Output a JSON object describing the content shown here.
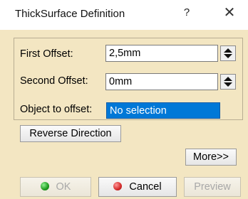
{
  "window": {
    "title": "ThickSurface Definition",
    "help_glyph": "?",
    "close_glyph": "✕"
  },
  "form": {
    "first_offset": {
      "label": "First Offset:",
      "value": "2,5mm"
    },
    "second_offset": {
      "label": "Second Offset:",
      "value": "0mm"
    },
    "object_to_offset": {
      "label": "Object to offset:",
      "value": "No selection"
    }
  },
  "buttons": {
    "reverse_direction": "Reverse Direction",
    "more": "More>>",
    "ok": "OK",
    "cancel": "Cancel",
    "preview": "Preview"
  },
  "colors": {
    "background": "#f3e6c2",
    "selection": "#0078d7"
  }
}
